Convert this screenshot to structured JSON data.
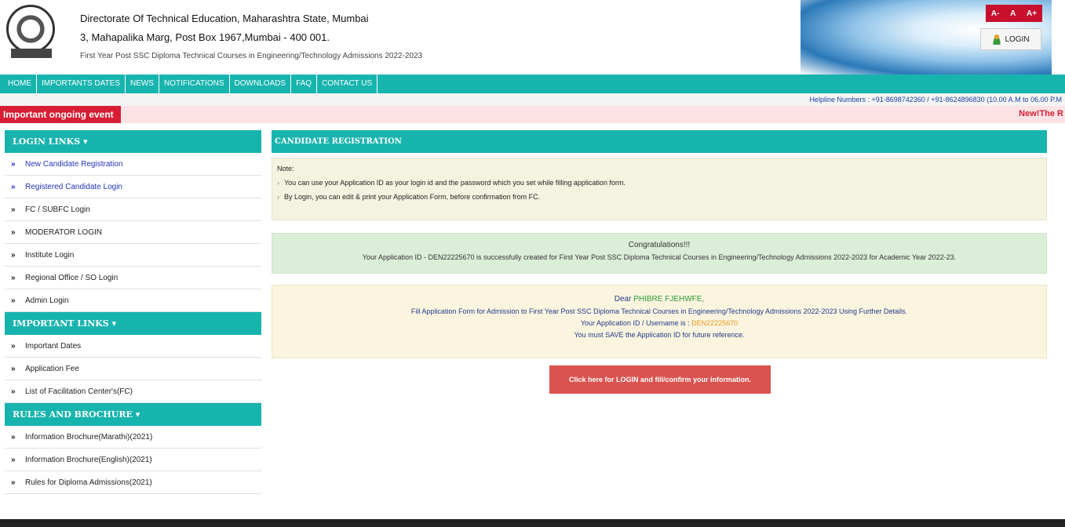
{
  "header": {
    "title": "Directorate Of Technical Education, Maharashtra State, Mumbai",
    "address": "3, Mahapalika Marg, Post Box 1967,Mumbai - 400 001.",
    "subtitle": "First Year Post SSC Diploma Technical Courses in Engineering/Technology Admissions 2022-2023",
    "font_controls": [
      "A-",
      "A",
      "A+"
    ],
    "login_label": "LOGIN"
  },
  "nav": {
    "items": [
      "HOME",
      "IMPORTANTS DATES",
      "NEWS",
      "NOTIFICATIONS",
      "DOWNLOADS",
      "FAQ",
      "CONTACT US"
    ]
  },
  "helpline": "Helpline Numbers : +91-8698742360 / +91-8624896830  (10.00 A.M to 06.00 P.M",
  "event": {
    "label": "Important ongoing event",
    "marquee": "New!The R"
  },
  "sidebar": {
    "login_links": {
      "heading": "LOGIN LINKS ▾",
      "items": [
        "New Candidate Registration",
        "Registered Candidate Login",
        "FC / SUBFC Login",
        "MODERATOR LOGIN",
        "Institute Login",
        "Regional Office / SO Login",
        "Admin Login"
      ]
    },
    "important_links": {
      "heading": "IMPORTANT LINKS ▾",
      "items": [
        "Important Dates",
        "Application Fee",
        "List of Facilitation Center's(FC)"
      ]
    },
    "rules": {
      "heading": "RULES AND BROCHURE ▾",
      "items": [
        "Information Brochure(Marathi)(2021)",
        "Information Brochure(English)(2021)",
        "Rules for Diploma Admissions(2021)"
      ]
    }
  },
  "main": {
    "heading": "CANDIDATE REGISTRATION",
    "note_title": "Note:",
    "notes": [
      "You can use your Application ID as your login id and the password which you set while filling application form.",
      "By Login, you can edit & print your Application Form, before confirmation from FC."
    ],
    "congrats_title": "Congratulations!!!",
    "congrats_text": "Your Application ID - DEN22225670 is successfully created for First Year Post SSC Diploma Technical Courses in Engineering/Technology Admissions 2022-2023 for Academic Year 2022-23.",
    "dear_prefix": "Dear",
    "candidate_name": "PHIBRE FJEHWFE,",
    "fill_text": "Fill Application Form for Admission to First Year Post SSC Diploma Technical Courses in Engineering/Technology Admissions 2022-2023 Using Further Details.",
    "app_id_label": "Your Application ID / Username is :",
    "app_id": "DEN22225670",
    "save_note": "You must SAVE the Application ID for future reference.",
    "cta_label": "Click here for LOGIN and fill/confirm your information."
  },
  "colors": {
    "teal": "#17b4ae",
    "red": "#d81e34",
    "cta": "#d9534f"
  }
}
